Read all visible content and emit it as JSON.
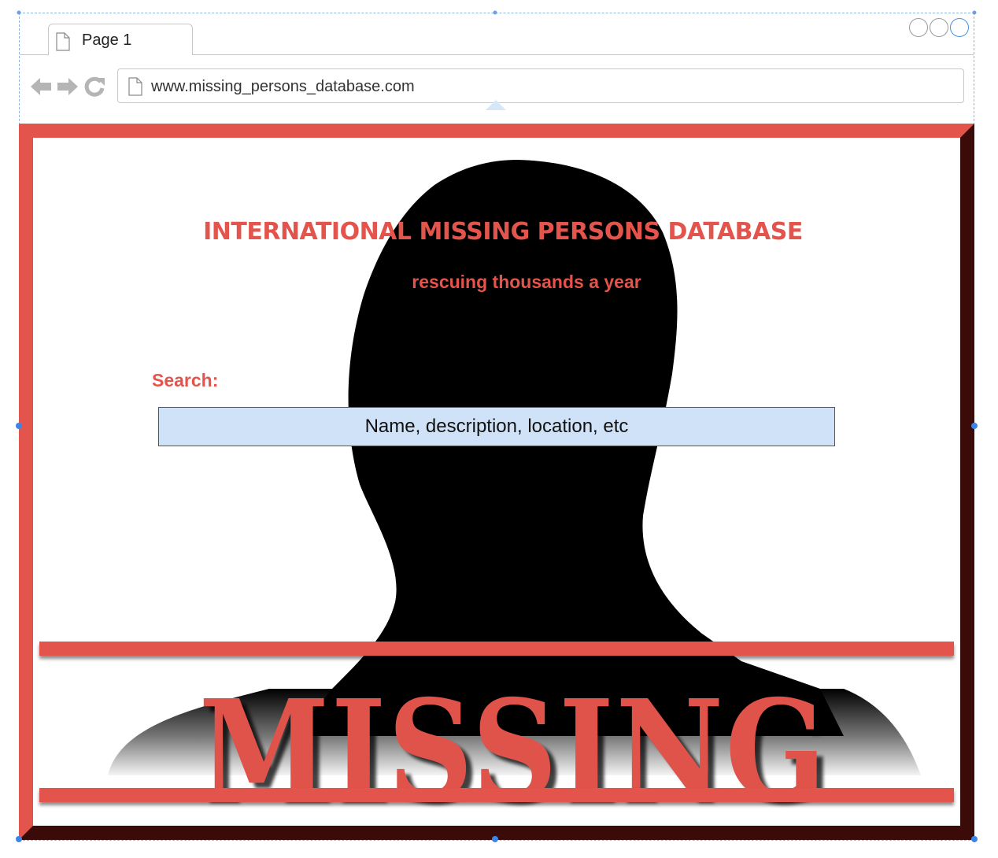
{
  "browser": {
    "tab_label": "Page 1",
    "url": "www.missing_persons_database.com"
  },
  "poster": {
    "title": "INTERNATIONAL MISSING PERSONS DATABASE",
    "subtitle": "rescuing thousands a year",
    "banner_word": "MISSING",
    "accent_color": "#e2544c"
  },
  "search": {
    "label": "Search:",
    "placeholder": "Name, description, location, etc"
  },
  "icons": {
    "back": "arrow-left-icon",
    "forward": "arrow-right-icon",
    "reload": "reload-icon",
    "page": "page-icon"
  }
}
